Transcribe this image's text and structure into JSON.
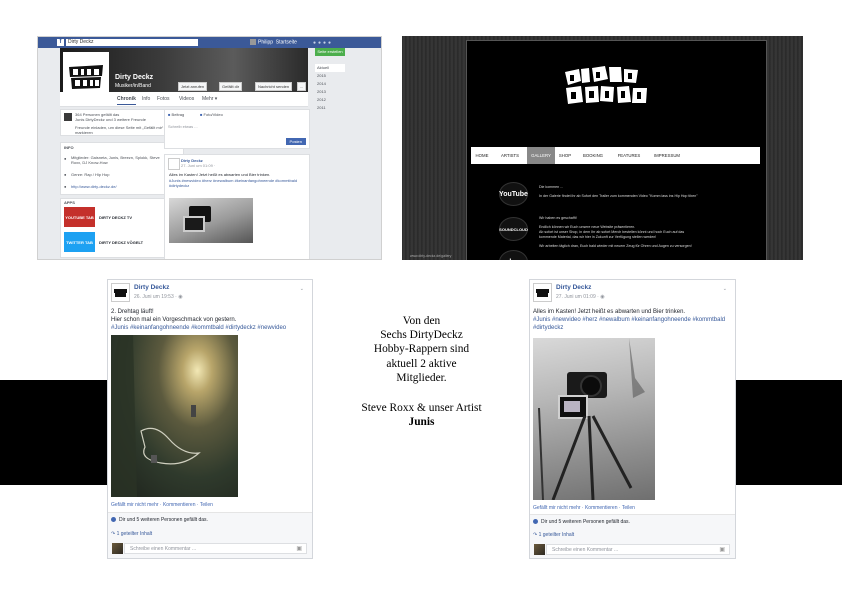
{
  "facebook_page": {
    "search_value": "Dirty Deckz",
    "user_name": "Philipp",
    "home_label": "Startseite",
    "page_name": "Dirty Deckz",
    "page_category": "Musiker/in/Band",
    "cover_buttons": [
      "Jetzt anrufen",
      "Gefällt dir",
      "Nachricht senden",
      "..."
    ],
    "side_button": "Seite erstellen",
    "timeline_years": [
      "Aktuell",
      "2015",
      "2014",
      "2013",
      "2012",
      "2011"
    ],
    "tabs": [
      "Chronik",
      "Info",
      "Fotos",
      "Videos",
      "Mehr ▾"
    ],
    "likes_count": "364 Personen gefällt das",
    "likes_sub": "Junis DirtyDeckz und 3 weitere Freunde",
    "invite_text": "Freunde einladen, um diese Seite mit „Gefällt mir“ zu markieren",
    "info_heading": "INFO",
    "info_members": "Mitglieder: Gaisneta, Junis, Breezn, Splokk, Steve Roxx, DJ Know-How",
    "info_genre": "Genre: Rap / Hip Hop",
    "info_url": "http://www.dirty-deckz.de/",
    "apps_heading": "APPS",
    "apps": [
      {
        "tile": "YOUTUBE TAB",
        "label": "DIRTY DECKZ TV"
      },
      {
        "tile": "TWITTER TAB",
        "label": "DIRTY DECKZ VÖGELT"
      }
    ],
    "composer_tabs": [
      "Beitrag",
      "Foto/Video"
    ],
    "composer_placeholder": "Schreib etwas ...",
    "post_button": "Posten",
    "post_name": "Dirty Deckz",
    "post_date": "27. Juni um 01:09 · ",
    "post_text": "Alles im Kasten! Jetzt heißt es abwarten und Bier trinken.",
    "post_tags": "#Junis #newvideo #herz #newalbum #keinanfangohneende #kommtbald #dirtydeckz"
  },
  "website": {
    "logo_text": "DIRTY DECKZ",
    "nav": [
      "HOME",
      "ARTISTS",
      "GALLERY",
      "SHOP",
      "BOOKING",
      "FEATURES",
      "IMPRESSUM"
    ],
    "active_nav": "GALLERY",
    "social_labels": [
      "YouTube",
      "SOUNDCLOUD",
      "bc"
    ],
    "text_1": "Die kommen ...",
    "text_2": "In der Galerie findet ihr ab Sofort den Trailer zum kommenden Video \"Komm lass ins Hip Hop tiben\"",
    "text_3": "Wir haben es geschafft!",
    "text_4": "Endlich können wir Euch unsere neue Website präsentieren.",
    "text_5": "Ab sofort ist unser Shop, in dem Ihr ab sofort Merch bestellen könnt und hoch Euch auf das",
    "text_6": "kommende Material, das wir hier in Zukunft zur Verfügung stellen werden!",
    "text_7": "Wir arbeiten täglich dran, Euch bald wieder mit neuem Zeug für Ohren und Augen zu versorgen!",
    "url": "www.dirty-deckz.de/gallery"
  },
  "post_left": {
    "name": "Dirty Deckz",
    "date": "26. Juni um 19:53 · ",
    "text_lines": [
      "2. Drehtag läuft!",
      "Hier schon mal ein Vorgeschmack von gestern."
    ],
    "tags": "#Junis #keinanfangohneende #kommtbald #dirtydeckz #newvideo",
    "actions": "Gefällt mir nicht mehr · Kommentieren · Teilen",
    "likes": "Dir und 5 weiteren Personen gefällt das.",
    "shares": "1 geteilter Inhalt",
    "comment_placeholder": "Schreibe einen Kommentar ..."
  },
  "post_right": {
    "name": "Dirty Deckz",
    "date": "27. Juni um 01:09 · ",
    "text_lines": [
      "Alles im Kasten! Jetzt heißt es abwarten und Bier trinken."
    ],
    "tags_lines": [
      "#Junis #newvideo #herz #newalbum #keinanfangohneende #kommtbald",
      "#dirtydeckz"
    ],
    "actions": "Gefällt mir nicht mehr · Kommentieren · Teilen",
    "likes": "Dir und 5 weiteren Personen gefällt das.",
    "shares": "1 geteilter Inhalt",
    "comment_placeholder": "Schreibe einen Kommentar ..."
  },
  "center_text": {
    "lines": [
      "Von den",
      "Sechs DirtyDeckz",
      "Hobby-Rappern sind",
      "aktuell 2 aktive",
      "Mitglieder."
    ],
    "line_2": "Steve Roxx & unser Artist",
    "bold_name": "Junis"
  }
}
